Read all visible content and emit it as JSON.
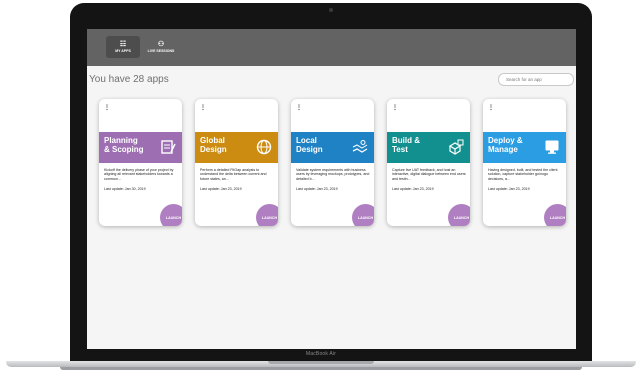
{
  "device": {
    "label": "MacBook Air"
  },
  "nav": {
    "items": [
      {
        "label": "MY APPS",
        "icon": "grid-icon",
        "active": true
      },
      {
        "label": "LIVE SESSIONS",
        "icon": "people-icon",
        "active": false
      }
    ]
  },
  "main": {
    "title": "You have 28 apps",
    "search_placeholder": "Search for an app"
  },
  "cards": [
    {
      "title_line1": "Planning",
      "title_line2": "& Scoping",
      "color": "#9d6fb2",
      "icon": "checklist-icon",
      "description": "Kickoff the delivery phase of your project by aligning all relevant stakeholders towards a common...",
      "last_update": "Last update: Jan 30, 2019",
      "launch": "LAUNCH"
    },
    {
      "title_line1": "Global",
      "title_line2": "Design",
      "color": "#cc8c12",
      "icon": "globe-icon",
      "description": "Perform a detailed FitGap analysis to understand the delta between current and future states, an...",
      "last_update": "Last update: Jan 23, 2019",
      "launch": "LAUNCH"
    },
    {
      "title_line1": "Local",
      "title_line2": "Design",
      "color": "#1f82c4",
      "icon": "map-icon",
      "description": "Validate system requirements with business users by leveraging mockups, prototypes, and detailed b...",
      "last_update": "Last update: Jan 23, 2019",
      "launch": "LAUNCH"
    },
    {
      "title_line1": "Build &",
      "title_line2": "Test",
      "color": "#12908f",
      "icon": "cubes-icon",
      "description": "Capture live UAT feedback, and host an interactive, digital dialogue between end users and testin...",
      "last_update": "Last update: Jan 23, 2019",
      "launch": "LAUNCH"
    },
    {
      "title_line1": "Deploy &",
      "title_line2": "Manage",
      "color": "#2a9de3",
      "icon": "monitor-icon",
      "description": "Having designed, built, and tested the client solution, capture stakeholder go/nogo decisions, a...",
      "last_update": "Last update: Jan 23, 2019",
      "launch": "LAUNCH"
    }
  ]
}
